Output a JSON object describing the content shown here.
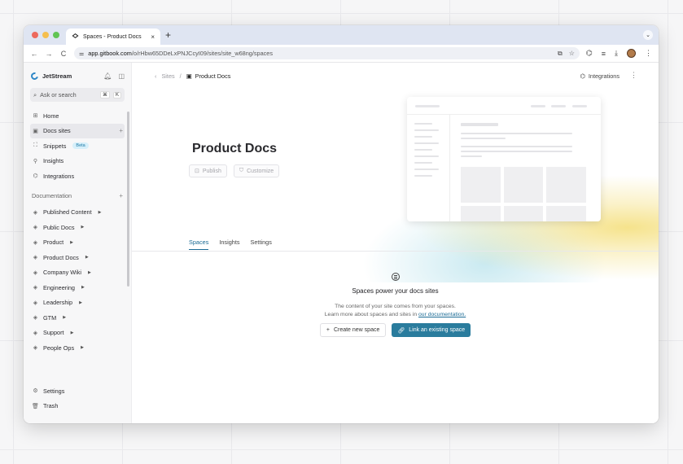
{
  "browser": {
    "tab_title": "Spaces - Product Docs",
    "tab_close": "×",
    "new_tab": "+",
    "url_host": "app.gitbook.com",
    "url_path": "/o/rHbw65DDeLxPNJCcyI09/sites/site_w68ng/spaces",
    "back": "←",
    "forward": "→",
    "reload": "C",
    "traffic_colors": [
      "#ed6a5e",
      "#f5bf4f",
      "#61c554"
    ]
  },
  "sidebar": {
    "org_name": "JetStream",
    "search_label": "Ask or search",
    "search_kbd": [
      "⌘",
      "K"
    ],
    "items": [
      {
        "label": "Home",
        "icon": "home-icon",
        "glyph": "⊞"
      },
      {
        "label": "Docs sites",
        "icon": "docs-sites-icon",
        "glyph": "▣"
      },
      {
        "label": "Snippets",
        "icon": "snippets-icon",
        "glyph": "⛶",
        "badge": "Beta"
      },
      {
        "label": "Insights",
        "icon": "insights-icon",
        "glyph": "⚲"
      },
      {
        "label": "Integrations",
        "icon": "integrations-icon",
        "glyph": "⌬"
      }
    ],
    "section_title": "Documentation",
    "spaces": [
      "Published Content",
      "Public Docs",
      "Product",
      "Product Docs",
      "Company Wiki",
      "Engineering",
      "Leadership",
      "GTM",
      "Support",
      "People Ops"
    ],
    "bottom": [
      {
        "label": "Settings",
        "glyph": "⚙"
      },
      {
        "label": "Trash",
        "glyph": "🗑"
      }
    ]
  },
  "header": {
    "crumb_root": "Sites",
    "crumb_current": "Product Docs",
    "integrations_label": "Integrations"
  },
  "hero": {
    "title": "Product Docs",
    "publish_label": "Publish",
    "customize_label": "Customize"
  },
  "tabs": [
    "Spaces",
    "Insights",
    "Settings"
  ],
  "empty_state": {
    "title": "Spaces power your docs sites",
    "desc_line1": "The content of your site comes from your spaces.",
    "desc_line2_prefix": "Learn more about spaces and sites in ",
    "desc_link": "our documentation.",
    "create_label": "Create new space",
    "link_label": "Link an existing space"
  }
}
